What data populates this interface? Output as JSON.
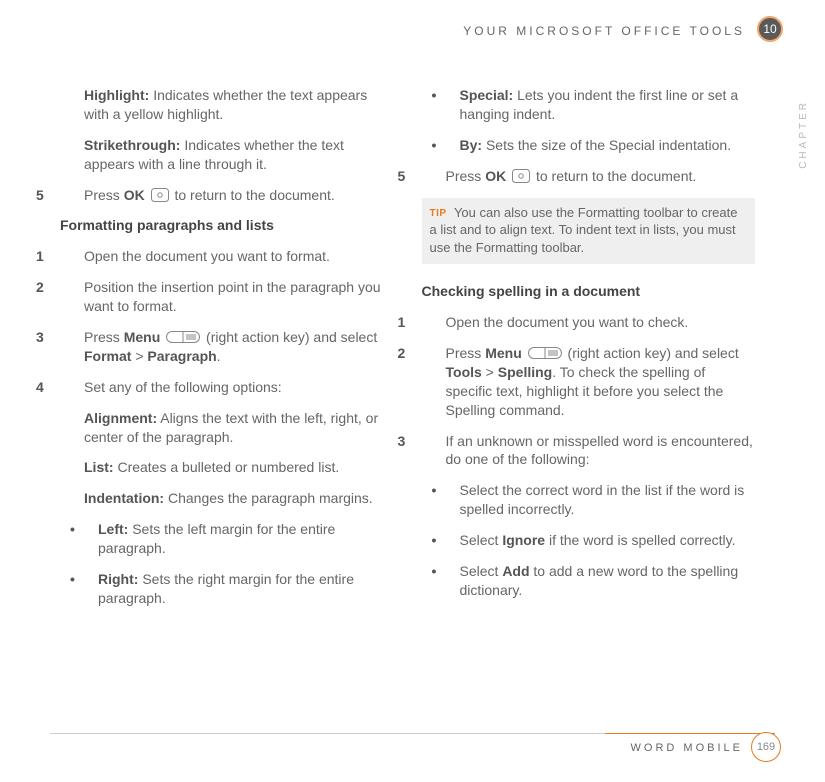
{
  "header": {
    "title": "YOUR MICROSOFT OFFICE TOOLS",
    "chapter_badge": "10",
    "chapter_side_label": "CHAPTER"
  },
  "left": {
    "highlight_label": "Highlight:",
    "highlight_text": " Indicates whether the text appears with a yellow highlight.",
    "strike_label": "Strikethrough:",
    "strike_text": " Indicates whether the text appears with a line through it.",
    "step5_num": "5",
    "step5_a": "Press ",
    "step5_ok": "OK",
    "step5_b": " to return to the document.",
    "heading": "Formatting paragraphs and lists",
    "s1_num": "1",
    "s1_text": "Open the document you want to format.",
    "s2_num": "2",
    "s2_text": "Position the insertion point in the paragraph you want to format.",
    "s3_num": "3",
    "s3_a": "Press ",
    "s3_menu": "Menu",
    "s3_b": " (right action key) and select ",
    "s3_format": "Format",
    "s3_gt": " > ",
    "s3_paragraph": "Paragraph",
    "s3_end": ".",
    "s4_num": "4",
    "s4_text": "Set any of the following options:",
    "align_label": "Alignment:",
    "align_text": " Aligns the text with the left, right, or center of the paragraph.",
    "list_label": "List:",
    "list_text": " Creates a bulleted or numbered list.",
    "indent_label": "Indentation:",
    "indent_text": " Changes the paragraph margins.",
    "bullet": "•",
    "left_label": "Left:",
    "left_text": " Sets the left margin for the entire paragraph.",
    "right_label": "Right:",
    "right_text": " Sets the right margin for the entire paragraph."
  },
  "right": {
    "bullet": "•",
    "special_label": "Special:",
    "special_text": " Lets you indent the first line or set a hanging indent.",
    "by_label": "By:",
    "by_text": " Sets the size of the Special indentation.",
    "step5_num": "5",
    "step5_a": "Press ",
    "step5_ok": "OK",
    "step5_b": " to return to the document.",
    "tip_label": "TIP",
    "tip_text": " You can also use the Formatting toolbar to create a list and to align text. To indent text in lists, you must use the Formatting toolbar.",
    "heading": "Checking spelling in a document",
    "c1_num": "1",
    "c1_text": "Open the document you want to check.",
    "c2_num": "2",
    "c2_a": "Press ",
    "c2_menu": "Menu",
    "c2_b": " (right action key) and select ",
    "c2_tools": "Tools",
    "c2_gt": " > ",
    "c2_spelling": "Spelling",
    "c2_c": ". To check the spelling of specific text, highlight it before you select the Spelling command.",
    "c3_num": "3",
    "c3_text": "If an unknown or misspelled word is encountered, do one of the following:",
    "c3b1": "Select the correct word in the list if the word is spelled incorrectly.",
    "c3b2a": "Select ",
    "c3b2_ignore": "Ignore",
    "c3b2b": " if the word is spelled correctly.",
    "c3b3a": "Select ",
    "c3b3_add": "Add",
    "c3b3b": " to add a new word to the spelling dictionary."
  },
  "footer": {
    "label": "WORD MOBILE",
    "page": "169"
  }
}
